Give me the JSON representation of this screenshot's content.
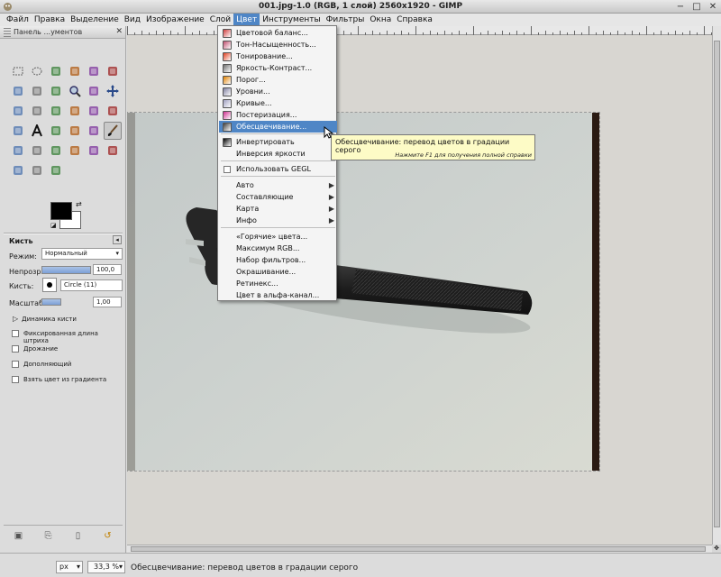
{
  "window": {
    "title": "001.jpg-1.0 (RGB, 1 слой) 2560x1920 - GIMP",
    "controls": [
      "−",
      "□",
      "✕"
    ]
  },
  "menubar": {
    "items": [
      "Файл",
      "Правка",
      "Выделение",
      "Вид",
      "Изображение",
      "Слой",
      "Цвет",
      "Инструменты",
      "Фильтры",
      "Окна",
      "Справка"
    ],
    "active": "Цвет"
  },
  "toolbox": {
    "title": "Панель ...ументов",
    "tools": [
      "rect-select",
      "ellipse-select",
      "free-select",
      "fuzzy-select",
      "color-select",
      "scissors",
      "foreground-select",
      "paths",
      "color-picker",
      "zoom",
      "measure",
      "move",
      "align",
      "crop",
      "rotate",
      "scale",
      "shear",
      "perspective",
      "flip",
      "text",
      "bucket-fill",
      "blend",
      "pencil",
      "paintbrush",
      "eraser",
      "airbrush",
      "ink",
      "clone",
      "heal",
      "perspective-clone",
      "blur",
      "smudge",
      "dodge-burn"
    ],
    "selected_tool": "paintbrush",
    "colors": {
      "foreground": "#000000",
      "background": "#ffffff"
    }
  },
  "tool_options": {
    "title": "Кисть",
    "mode_label": "Режим:",
    "mode_value": "Нормальный",
    "opacity_label": "Непрозр.",
    "opacity_value": "100,0",
    "opacity_fraction": 1.0,
    "brush_label": "Кисть:",
    "brush_value": "Circle (11)",
    "scale_label": "Масштаб:",
    "scale_value": "1,00",
    "scale_fraction": 0.4,
    "expander_label": "Динамика кисти",
    "checkboxes": [
      "Фиксированная длина штриха",
      "Дрожание",
      "Дополняющий",
      "Взять цвет из градиента"
    ]
  },
  "color_menu": {
    "items": [
      {
        "label": "Цветовой баланс...",
        "icon": "#d04040"
      },
      {
        "label": "Тон-Насыщенность...",
        "icon": "#c05070"
      },
      {
        "label": "Тонирование...",
        "icon": "#e04020"
      },
      {
        "label": "Яркость-Контраст...",
        "icon": "#707070"
      },
      {
        "label": "Порог...",
        "icon": "#e08000"
      },
      {
        "label": "Уровни...",
        "icon": "#8080a0"
      },
      {
        "label": "Кривые...",
        "icon": "#a0a0c0"
      },
      {
        "label": "Постеризация...",
        "icon": "#d03090"
      },
      {
        "label": "Обесцвечивание...",
        "icon": "#404040",
        "highlighted": true
      },
      {
        "label": "Инвертировать",
        "icon": "#000000"
      },
      {
        "label": "Инверсия яркости",
        "icon": null
      },
      {
        "label": "Использовать GEGL",
        "checkbox": true
      },
      {
        "label": "Авто",
        "submenu": true
      },
      {
        "label": "Составляющие",
        "submenu": true
      },
      {
        "label": "Карта",
        "submenu": true
      },
      {
        "label": "Инфо",
        "submenu": true
      },
      {
        "label": "«Горячие» цвета...",
        "icon": null
      },
      {
        "label": "Максимум RGB...",
        "icon": null
      },
      {
        "label": "Набор фильтров...",
        "icon": null
      },
      {
        "label": "Окрашивание...",
        "icon": null
      },
      {
        "label": "Ретинекс...",
        "icon": null
      },
      {
        "label": "Цвет в альфа-канал...",
        "icon": null
      }
    ]
  },
  "tooltip": {
    "text": "Обесцвечивание: перевод цветов в градации серого",
    "hint": "Нажмите F1 для получения полной справки"
  },
  "statusbar": {
    "unit": "px",
    "zoom": "33,3 %",
    "message": "Обесцвечивание: перевод цветов в градации серого"
  }
}
